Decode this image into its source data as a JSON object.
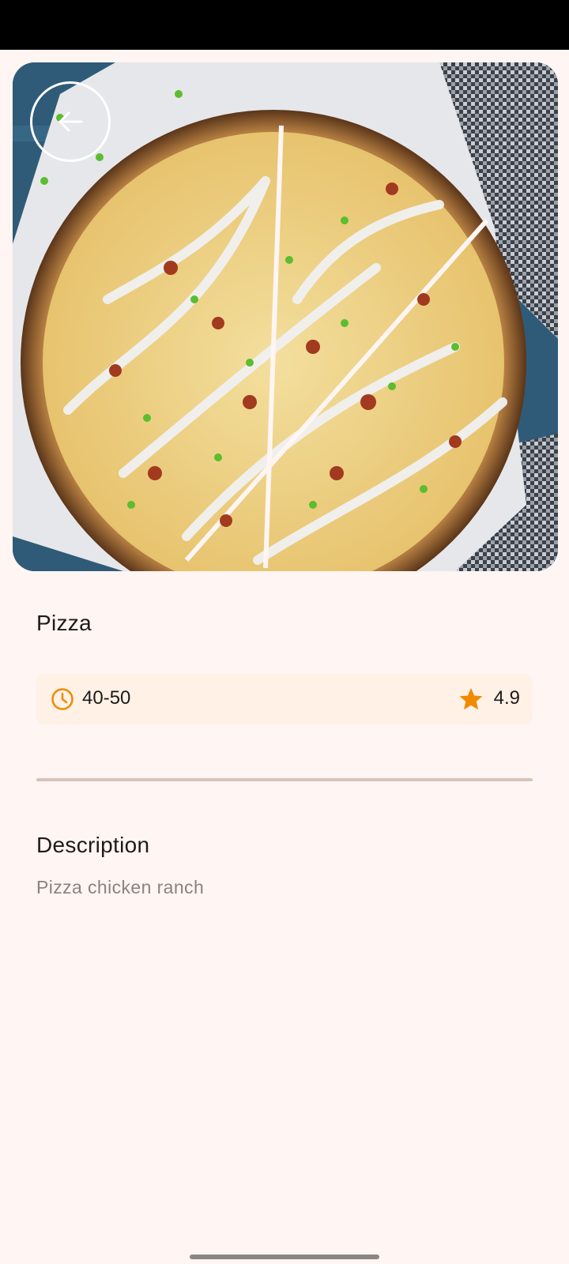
{
  "recipe": {
    "title": "Pizza",
    "time": "40-50",
    "rating": "4.9",
    "description_heading": "Description",
    "description": "Pizza chicken ranch"
  },
  "icons": {
    "back": "arrow-left-icon",
    "time": "clock-icon",
    "rating": "star-icon"
  },
  "colors": {
    "accent": "#f08a00",
    "background": "#fff5f3",
    "card": "#fff1e6",
    "divider": "#d8c3b8"
  }
}
